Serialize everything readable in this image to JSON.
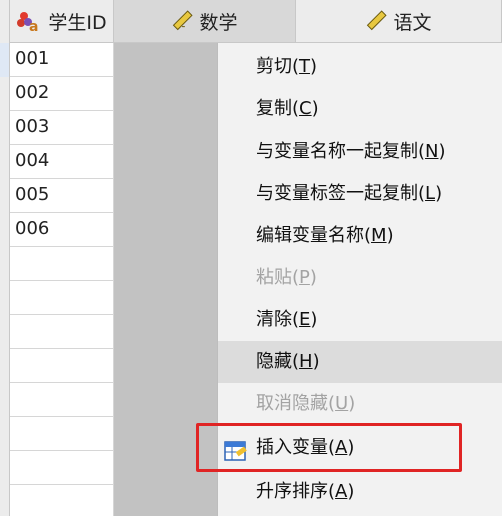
{
  "columns": {
    "id_header": "学生ID",
    "math_header": "数学",
    "chinese_header": "语文"
  },
  "rows": [
    "001",
    "002",
    "003",
    "004",
    "005",
    "006"
  ],
  "context_menu": {
    "items": [
      {
        "label": "剪切(",
        "mnemonic": "T",
        "end": ")",
        "enabled": true
      },
      {
        "label": "复制(",
        "mnemonic": "C",
        "end": ")",
        "enabled": true
      },
      {
        "label": "与变量名称一起复制(",
        "mnemonic": "N",
        "end": ")",
        "enabled": true
      },
      {
        "label": "与变量标签一起复制(",
        "mnemonic": "L",
        "end": ")",
        "enabled": true
      },
      {
        "label": "编辑变量名称(",
        "mnemonic": "M",
        "end": ")",
        "enabled": true
      },
      {
        "label": "粘贴(",
        "mnemonic": "P",
        "end": ")",
        "enabled": false
      },
      {
        "label": "清除(",
        "mnemonic": "E",
        "end": ")",
        "enabled": true
      },
      {
        "label": "隐藏(",
        "mnemonic": "H",
        "end": ")",
        "enabled": true
      },
      {
        "label": "取消隐藏(",
        "mnemonic": "U",
        "end": ")",
        "enabled": false
      },
      {
        "label": "插入变量(",
        "mnemonic": "A",
        "end": ")",
        "enabled": true
      },
      {
        "label": "升序排序(",
        "mnemonic": "A",
        "end": ")",
        "enabled": true
      }
    ]
  },
  "colors": {
    "highlight": "#e02424",
    "menu_bg": "#f2f2f2",
    "selected_column": "#c2c2c2"
  },
  "icons": {
    "id_column": "nominal-variable-icon",
    "scale_column": "ruler-icon",
    "insert_variable": "insert-variable-icon"
  }
}
